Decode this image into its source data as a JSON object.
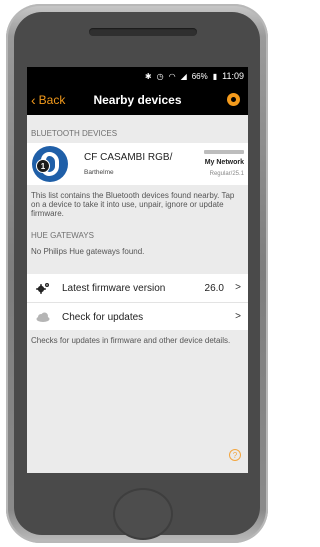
{
  "status_bar": {
    "icons": [
      "bluetooth-icon",
      "alarm-icon",
      "wifi-icon",
      "signal-icon",
      "battery-icon"
    ],
    "battery": "66%",
    "time": "11:09"
  },
  "nav": {
    "back_label": "Back",
    "title": "Nearby devices",
    "accent_color": "#f39a1c"
  },
  "bluetooth": {
    "header": "BLUETOOTH DEVICES",
    "device": {
      "name": "CF CASAMBI RGB/",
      "vendor": "Barthelme",
      "badge": "1",
      "network": "My Network",
      "version": "Regular/25.1",
      "logo_color": "#1f5fa8"
    },
    "info": "This list contains the Bluetooth devices found nearby. Tap on a device to take it into use, unpair, ignore or update firmware."
  },
  "hue": {
    "header": "HUE GATEWAYS",
    "text": "No Philips Hue gateways found."
  },
  "rows": {
    "firmware_label": "Latest firmware version",
    "firmware_value": "26.0",
    "updates_label": "Check for updates",
    "chevron": ">"
  },
  "bottom_info": "Checks for updates in firmware and other device details.",
  "help_symbol": "?"
}
